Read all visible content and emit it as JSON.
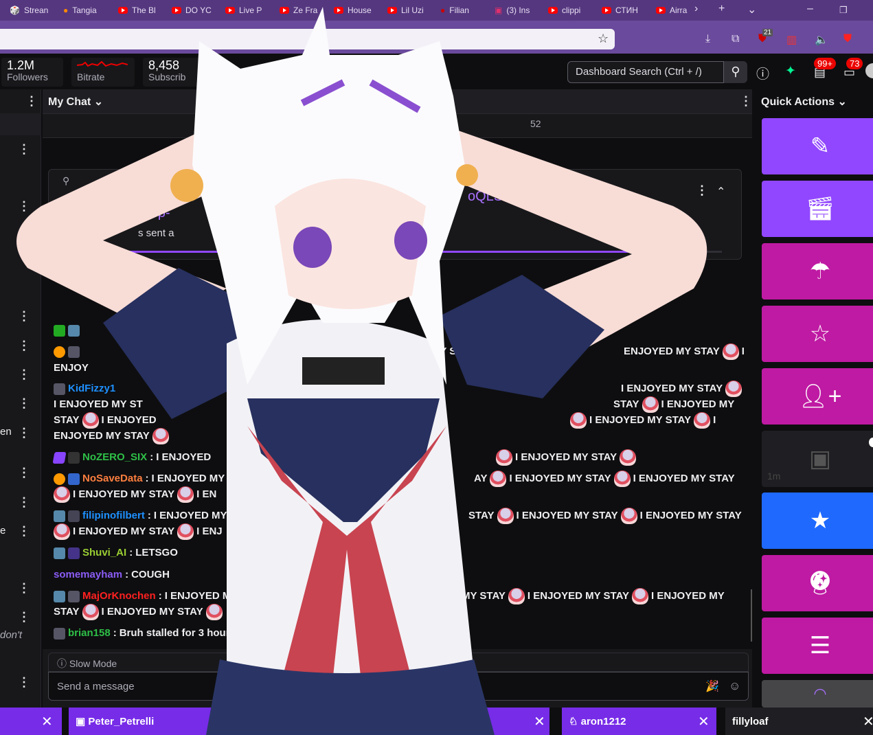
{
  "browser": {
    "tabs": [
      "Strean",
      "Tangia",
      "The Bl",
      "DO YC",
      "Live P",
      "Ze Fra",
      "House",
      "Lil Uzi",
      "Filian",
      "(3) Ins",
      "clippi",
      "СТИН",
      "Airra"
    ],
    "extension_badge": "21"
  },
  "dashboard": {
    "stats": [
      {
        "value": "1.2M",
        "label": "Followers"
      },
      {
        "value": "",
        "label": "Bitrate"
      },
      {
        "value": "8,458",
        "label": "Subscrib"
      }
    ],
    "search_placeholder": "Dashboard Search (Ctrl + /)",
    "badges": {
      "inbox": "99+",
      "notifications": "73"
    }
  },
  "sidebar": {
    "fragments": [
      "en",
      "e",
      "don't"
    ]
  },
  "chat": {
    "title": "My Chat",
    "tab_count": "52",
    "pinned": {
      "line1": "rFp-",
      "line2": "s sent a",
      "link": "oQLSe6H",
      "progress": 0.9
    },
    "messages": [
      {
        "user": "",
        "color": "#efeff1",
        "text": "ENJOY",
        "right": "NJOYED MY STAY"
      },
      {
        "user": "KidFizzy1",
        "color": "#1e90ff",
        "text": "",
        "right": "I ENJOYED MY STAY"
      },
      {
        "user": "",
        "color": "",
        "text": "I ENJOYED MY ST",
        "right": "STAY"
      },
      {
        "user": "NoZERO_SIX",
        "color": "#2ebf47",
        "text": "I ENJOYED",
        "right": "I ENJOYED MY STAY"
      },
      {
        "user": "NoSaveData",
        "color": "#ff7f3f",
        "text": "I ENJOYED MY",
        "right": "I ENJOYED MY STAY"
      },
      {
        "user": "filipinofilbert",
        "color": "#1e90ff",
        "text": "I ENJOYED MY",
        "right": "I ENJOYED MY STAY"
      },
      {
        "user": "Shuvi_AI",
        "color": "#9acd32",
        "text": "LETSGO"
      },
      {
        "user": "somemayham",
        "color": "#8a5cf5",
        "text": "COUGH"
      },
      {
        "user": "MajOrKnochen",
        "color": "#ff2020",
        "text": "I ENJOYED M",
        "right": "MY STAY"
      },
      {
        "user": "brian158",
        "color": "#2ebf47",
        "text": "Bruh stalled for 3 hours"
      }
    ],
    "phrase": "I ENJOYED MY STAY",
    "stay": "STAY",
    "i": "I",
    "ay": "AY",
    "en": "I EN",
    "enj": "I ENJ",
    "enjoyed": "I ENJOYED",
    "enjoyed_my": "I ENJOYED MY",
    "enjoyed_my_stay2": "ENJOYED MY STAY",
    "slow_mode": "Slow Mode",
    "input_placeholder": "Send a message"
  },
  "quick_actions": {
    "title": "Quick Actions",
    "timer": "1m"
  },
  "bottom_tabs": [
    {
      "label": "Peter_Petrelli"
    },
    {
      "label": "aron1212"
    },
    {
      "label": "fillyloaf"
    }
  ],
  "colors": {
    "purple": "#9147ff",
    "magenta": "#bf1aa3",
    "blue": "#1f69ff"
  }
}
